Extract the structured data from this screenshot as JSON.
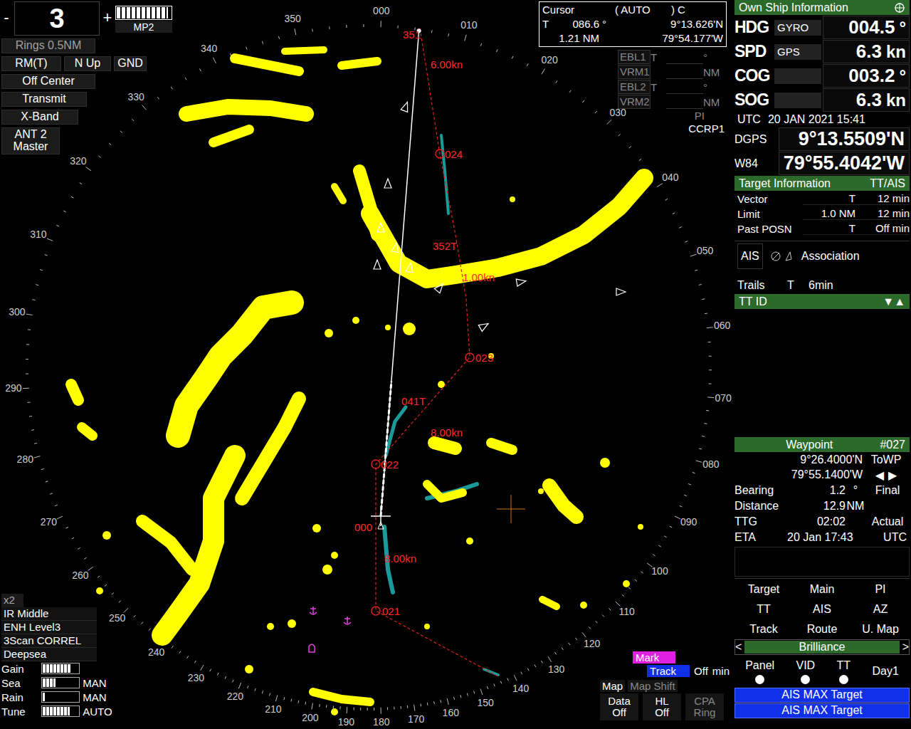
{
  "range": {
    "minus": "-",
    "value": "3",
    "plus": "+",
    "bar_label": "MP2",
    "bar_level": 0.95
  },
  "display_modes": {
    "rings": "Rings 0.5NM",
    "motion": "RM(T)",
    "orientation": "N Up",
    "stabilization": "GND",
    "center": "Off Center",
    "status": "Transmit",
    "band": "X-Band",
    "antenna": [
      "ANT 2",
      "Master"
    ]
  },
  "cursor": {
    "title": "Cursor",
    "mode": "( AUTO",
    "mode_close": ")",
    "flag": "C",
    "ref": "T",
    "bearing": "086.6",
    "deg": "°",
    "lat": "9°13.626'N",
    "range": "1.21 NM",
    "lon": "79°54.177'W"
  },
  "markers": [
    {
      "label": "EBL1",
      "ref": "T",
      "unit": "°"
    },
    {
      "label": "VRM1",
      "ref": "",
      "unit": "NM"
    },
    {
      "label": "EBL2",
      "ref": "T",
      "unit": "°"
    },
    {
      "label": "VRM2",
      "ref": "",
      "unit": "NM"
    }
  ],
  "pi": "PI",
  "ccrp": "CCRP1",
  "own_ship": {
    "title": "Own Ship Information",
    "rows": [
      {
        "label": "HDG",
        "source": "GYRO",
        "value": "004.5",
        "unit": "°"
      },
      {
        "label": "SPD",
        "source": "GPS",
        "value": "6.3",
        "unit": "kn"
      },
      {
        "label": "COG",
        "source": "",
        "value": "003.2",
        "unit": "°"
      },
      {
        "label": "SOG",
        "source": "",
        "value": "6.3",
        "unit": "kn"
      }
    ],
    "utc": {
      "label": "UTC",
      "value": "20 JAN 2021 15:41"
    },
    "positions": [
      {
        "label": "DGPS",
        "value": "9°13.5509'N"
      },
      {
        "label": "W84",
        "value": "79°55.4042'W"
      }
    ]
  },
  "target_info": {
    "title": "Target Information",
    "mode": "TT/AIS",
    "rows": [
      {
        "label": "Vector",
        "a": "T",
        "b": "12 min"
      },
      {
        "label": "Limit",
        "a": "1.0 NM",
        "b": "12 min"
      },
      {
        "label": "Past POSN",
        "a": "T",
        "b": "Off min"
      }
    ]
  },
  "ais": {
    "label": "AIS",
    "association": "Association"
  },
  "trails": {
    "label": "Trails",
    "ref": "T",
    "value": "6min"
  },
  "tt_list": {
    "title": "TT ID",
    "sort": "▼▲"
  },
  "waypoint": {
    "title": "Waypoint",
    "number": "#027",
    "lat": "9°26.4000'N",
    "to": "ToWP",
    "lon": "79°55.1400'W",
    "prev": "◀",
    "next": "▶",
    "rows": [
      {
        "label": "Bearing",
        "value": "1.2",
        "unit": "°",
        "tag": "Final"
      },
      {
        "label": "Distance",
        "value": "12.9",
        "unit": "NM",
        "tag": ""
      },
      {
        "label": "TTG",
        "value": "02:02",
        "unit": "",
        "tag": "Actual"
      },
      {
        "label": "ETA",
        "value": "20 Jan 17:43",
        "unit": "",
        "tag": "UTC"
      }
    ]
  },
  "menu_buttons": [
    "Target",
    "Main",
    "PI",
    "TT",
    "AIS",
    "AZ",
    "Track",
    "Route",
    "U. Map"
  ],
  "brilliance": {
    "prev": "<",
    "title": "Brilliance",
    "next": ">",
    "items": [
      "Panel",
      "VID",
      "TT"
    ],
    "mode": "Day1"
  },
  "alerts": [
    "AIS MAX Target",
    "AIS MAX Target"
  ],
  "bottom_left": {
    "zoom": "x2",
    "settings": [
      "IR Middle",
      "ENH Level3",
      "3Scan CORREL",
      "Deepsea"
    ],
    "controls": [
      {
        "label": "Gain",
        "level": 0.8,
        "mode": ""
      },
      {
        "label": "Sea",
        "level": 0.35,
        "mode": "MAN"
      },
      {
        "label": "Rain",
        "level": 0.05,
        "mode": "MAN"
      },
      {
        "label": "Tune",
        "level": 0.75,
        "mode": "AUTO"
      }
    ]
  },
  "bottom_center": {
    "mark": "Mark",
    "track": "Track",
    "track_value": "Off",
    "track_unit": "min",
    "map": "Map",
    "map_shift": "Map Shift",
    "map_shift_disabled": true,
    "buttons": [
      {
        "top": "Data",
        "bottom": "Off",
        "disabled": false
      },
      {
        "top": "HL",
        "bottom": "Off",
        "disabled": false
      },
      {
        "top": "CPA",
        "bottom": "Ring",
        "disabled": true
      }
    ]
  },
  "bearing_labels": [
    "000",
    "010",
    "020",
    "030",
    "040",
    "050",
    "060",
    "070",
    "080",
    "090",
    "100",
    "110",
    "120",
    "130",
    "140",
    "150",
    "160",
    "170",
    "180",
    "190",
    "200",
    "210",
    "220",
    "230",
    "240",
    "250",
    "260",
    "270",
    "280",
    "290",
    "300",
    "310",
    "320",
    "330",
    "340",
    "350"
  ],
  "route_labels": [
    "351",
    "6.00kn",
    "024",
    "352T",
    "1.00kn",
    "023",
    "041T",
    "8.00kn",
    "022",
    "000",
    "8.00kn",
    "021"
  ]
}
